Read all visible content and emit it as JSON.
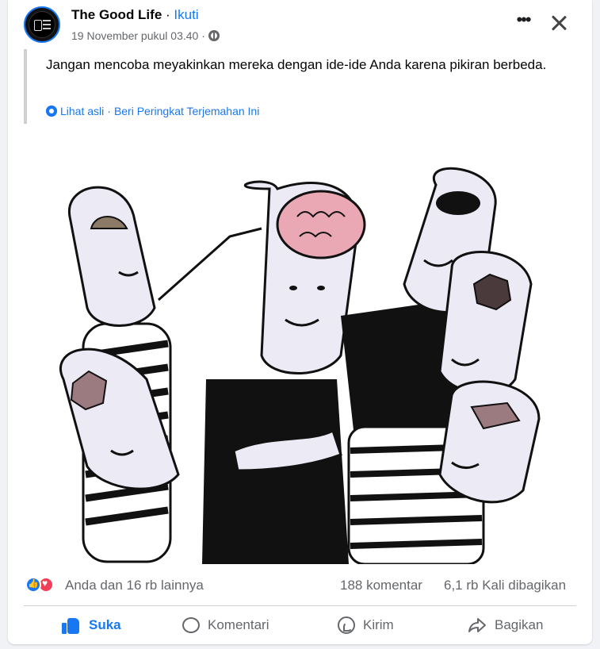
{
  "post": {
    "page_name": "The Good Life",
    "separator": "·",
    "follow_label": "Ikuti",
    "timestamp": "19 November pukul 03.40 ·",
    "text": "Jangan mencoba meyakinkan mereka dengan ide-ide Anda karena pikiran berbeda.",
    "translation": {
      "see_original": "Lihat asli",
      "separator": "·",
      "rate": "Beri Peringkat Terjemahan Ini"
    }
  },
  "stats": {
    "reactions": "Anda dan 16 rb lainnya",
    "comments": "188 komentar",
    "shares": "6,1 rb Kali dibagikan"
  },
  "actions": {
    "like": "Suka",
    "comment": "Komentari",
    "send": "Kirim",
    "share": "Bagikan"
  },
  "icons": [
    "globe-icon",
    "more-icon",
    "close-icon",
    "gear-icon",
    "like-reaction-icon",
    "love-reaction-icon",
    "thumb-up-icon",
    "comment-icon",
    "whatsapp-icon",
    "share-icon"
  ],
  "colors": {
    "accent": "#1877f2",
    "muted_text": "#65676b",
    "love": "#f33e58"
  }
}
